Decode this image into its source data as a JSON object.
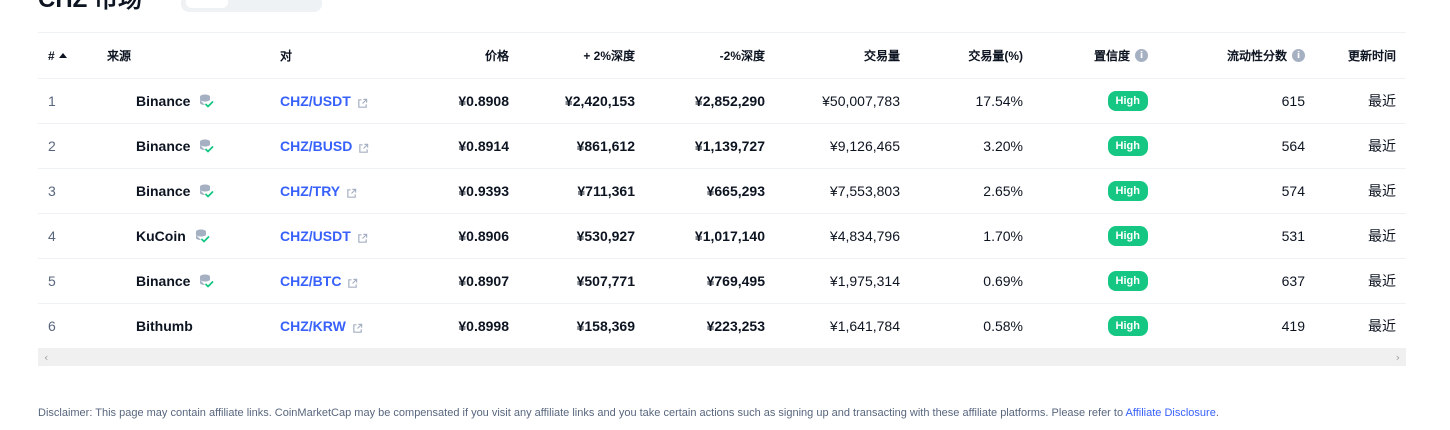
{
  "page": {
    "title": "CHZ 市场"
  },
  "table": {
    "headers": {
      "rank": "#",
      "source": "来源",
      "pair": "对",
      "price": "价格",
      "plus_depth": "+ 2%深度",
      "minus_depth": "-2%深度",
      "volume": "交易量",
      "volume_pct": "交易量(%)",
      "confidence": "置信度",
      "liquidity": "流动性分数",
      "updated": "更新时间"
    },
    "rows": [
      {
        "rank": "1",
        "source": "Binance",
        "verified": true,
        "pair": "CHZ/USDT",
        "price": "¥0.8908",
        "plus_depth": "¥2,420,153",
        "minus_depth": "¥2,852,290",
        "volume": "¥50,007,783",
        "volume_pct": "17.54%",
        "confidence": "High",
        "liquidity": "615",
        "updated": "最近"
      },
      {
        "rank": "2",
        "source": "Binance",
        "verified": true,
        "pair": "CHZ/BUSD",
        "price": "¥0.8914",
        "plus_depth": "¥861,612",
        "minus_depth": "¥1,139,727",
        "volume": "¥9,126,465",
        "volume_pct": "3.20%",
        "confidence": "High",
        "liquidity": "564",
        "updated": "最近"
      },
      {
        "rank": "3",
        "source": "Binance",
        "verified": true,
        "pair": "CHZ/TRY",
        "price": "¥0.9393",
        "plus_depth": "¥711,361",
        "minus_depth": "¥665,293",
        "volume": "¥7,553,803",
        "volume_pct": "2.65%",
        "confidence": "High",
        "liquidity": "574",
        "updated": "最近"
      },
      {
        "rank": "4",
        "source": "KuCoin",
        "verified": true,
        "pair": "CHZ/USDT",
        "price": "¥0.8906",
        "plus_depth": "¥530,927",
        "minus_depth": "¥1,017,140",
        "volume": "¥4,834,796",
        "volume_pct": "1.70%",
        "confidence": "High",
        "liquidity": "531",
        "updated": "最近"
      },
      {
        "rank": "5",
        "source": "Binance",
        "verified": true,
        "pair": "CHZ/BTC",
        "price": "¥0.8907",
        "plus_depth": "¥507,771",
        "minus_depth": "¥769,495",
        "volume": "¥1,975,314",
        "volume_pct": "0.69%",
        "confidence": "High",
        "liquidity": "637",
        "updated": "最近"
      },
      {
        "rank": "6",
        "source": "Bithumb",
        "verified": false,
        "pair": "CHZ/KRW",
        "price": "¥0.8998",
        "plus_depth": "¥158,369",
        "minus_depth": "¥223,253",
        "volume": "¥1,641,784",
        "volume_pct": "0.58%",
        "confidence": "High",
        "liquidity": "419",
        "updated": "最近"
      }
    ]
  },
  "disclaimer": {
    "text": "Disclaimer: This page may contain affiliate links. CoinMarketCap may be compensated if you visit any affiliate links and you take certain actions such as signing up and transacting with these affiliate platforms. Please refer to ",
    "link": "Affiliate Disclosure",
    "end": "."
  },
  "icons": {
    "sort": "sort-ascending-icon",
    "info": "info-icon",
    "verified": "verified-database-icon",
    "external": "external-link-icon"
  },
  "colors": {
    "link": "#3861fb",
    "high_badge": "#16c784",
    "muted": "#58667e",
    "text": "#0d1421"
  }
}
